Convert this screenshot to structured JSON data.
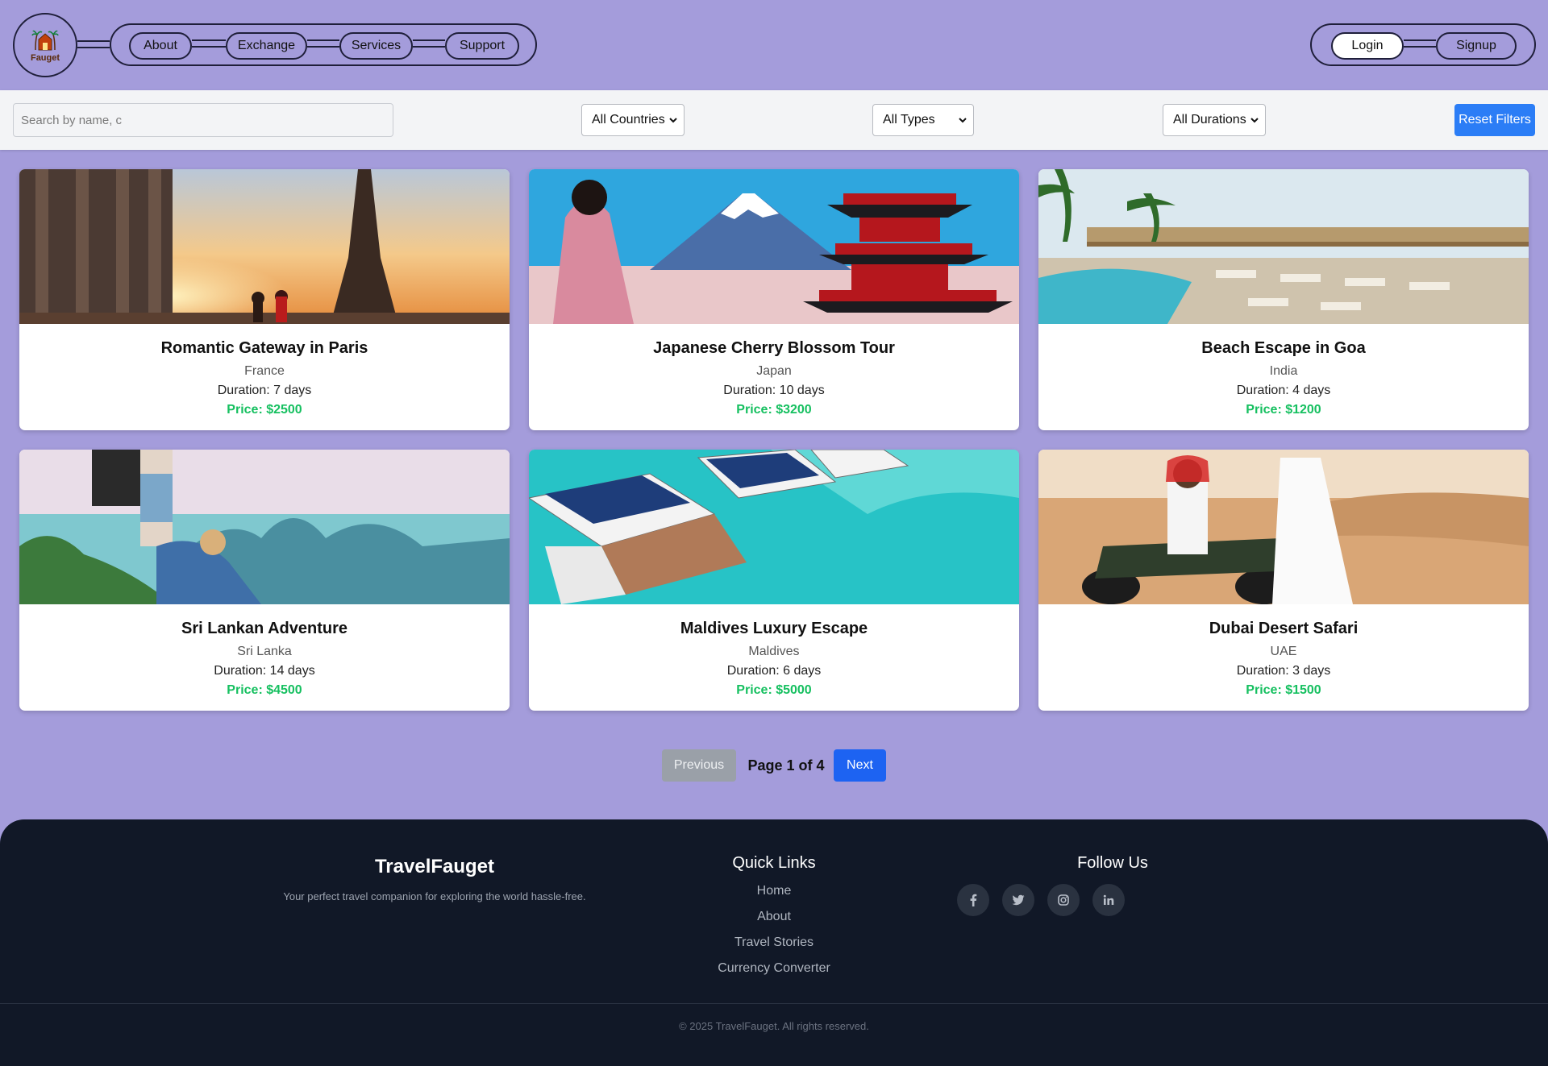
{
  "brand": {
    "logo_text": "Fauget"
  },
  "nav": {
    "items": [
      {
        "label": "About"
      },
      {
        "label": "Exchange"
      },
      {
        "label": "Services"
      },
      {
        "label": "Support"
      }
    ]
  },
  "auth": {
    "login_label": "Login",
    "signup_label": "Signup"
  },
  "filters": {
    "search_placeholder": "Search by name, c",
    "country": "All Countries",
    "type": "All Types",
    "duration": "All Durations",
    "reset_label": "Reset Filters"
  },
  "tours": [
    {
      "title": "Romantic Gateway in Paris",
      "country": "France",
      "duration": "Duration: 7 days",
      "price": "Price: $2500",
      "image": "paris-eiffel-tower"
    },
    {
      "title": "Japanese Cherry Blossom Tour",
      "country": "Japan",
      "duration": "Duration: 10 days",
      "price": "Price: $3200",
      "image": "mount-fuji-pagoda"
    },
    {
      "title": "Beach Escape in Goa",
      "country": "India",
      "duration": "Duration: 4 days",
      "price": "Price: $1200",
      "image": "resort-pool-palms"
    },
    {
      "title": "Sri Lankan Adventure",
      "country": "Sri Lanka",
      "duration": "Duration: 14 days",
      "price": "Price: $4500",
      "image": "hikers-mountains"
    },
    {
      "title": "Maldives Luxury Escape",
      "country": "Maldives",
      "duration": "Duration: 6 days",
      "price": "Price: $5000",
      "image": "overwater-villas"
    },
    {
      "title": "Dubai Desert Safari",
      "country": "UAE",
      "duration": "Duration: 3 days",
      "price": "Price: $1500",
      "image": "desert-quad-bike"
    }
  ],
  "pagination": {
    "previous_label": "Previous",
    "page_info": "Page 1 of 4",
    "next_label": "Next"
  },
  "footer": {
    "brand": "TravelFauget",
    "tagline": "Your perfect travel companion for exploring the world hassle-free.",
    "quick_links_heading": "Quick Links",
    "links": [
      "Home",
      "About",
      "Travel Stories",
      "Currency Converter"
    ],
    "follow_heading": "Follow Us",
    "social": [
      "facebook-icon",
      "twitter-icon",
      "instagram-icon",
      "linkedin-icon"
    ],
    "copyright": "© 2025 TravelFauget. All rights reserved."
  },
  "colors": {
    "page_bg": "#a49cdb",
    "accent_blue": "#2b7df6",
    "next_blue": "#1d63f2",
    "price_green": "#16c060",
    "footer_bg": "#111827"
  }
}
